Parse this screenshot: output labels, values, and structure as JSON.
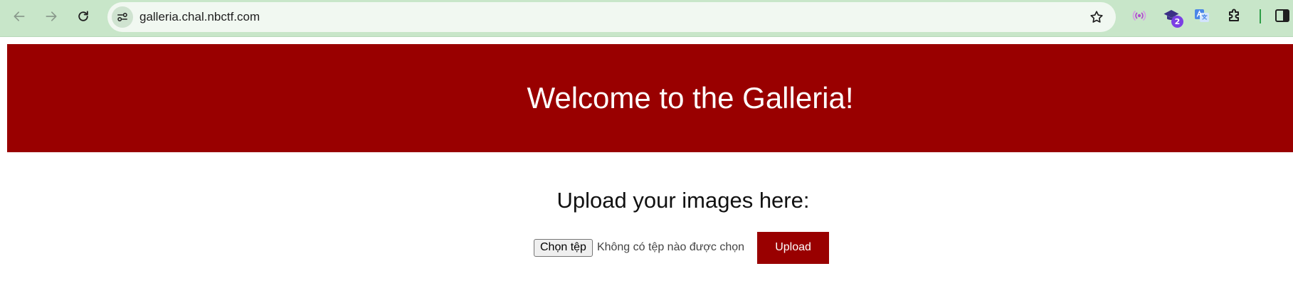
{
  "browser": {
    "url": "galleria.chal.nbctf.com",
    "icons": {
      "back": "arrow-left-icon",
      "forward": "arrow-right-icon",
      "reload": "reload-icon",
      "site_info": "tune-icon",
      "bookmark": "star-outline-icon",
      "extensions": [
        "broadcast-extension-icon",
        "graduation-cap-extension-icon",
        "google-translate-extension-icon",
        "puzzle-extensions-icon",
        "side-panel-icon"
      ]
    },
    "extension_badge": "2",
    "colors": {
      "toolbar": "#c8e6c9",
      "omnibox": "#f1f8f1",
      "badge": "#7b3fe4"
    }
  },
  "page": {
    "hero_title": "Welcome to the Galleria!",
    "upload_heading": "Upload your images here:",
    "choose_file_label": "Chọn tệp",
    "file_status": "Không có tệp nào được chọn",
    "upload_label": "Upload",
    "colors": {
      "accent": "#990000",
      "text": "#111111"
    }
  }
}
